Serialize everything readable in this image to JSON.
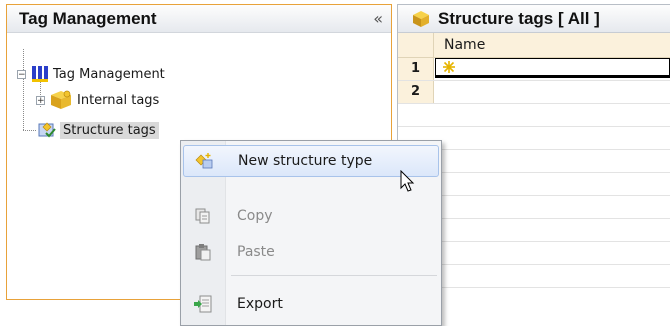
{
  "left_panel": {
    "title": "Tag Management",
    "collapse_glyph": "«",
    "tree": [
      {
        "label": "Tag Management",
        "expander": "−",
        "icon": "tag-management-icon"
      },
      {
        "label": "Internal tags",
        "expander": "+",
        "icon": "internal-tags-icon"
      },
      {
        "label": "Structure tags",
        "icon": "structure-tags-icon",
        "selected": true
      }
    ]
  },
  "right_panel": {
    "title": "Structure tags [ All ]",
    "icon": "structure-cube-icon",
    "column_name": "Name",
    "rows": [
      "1",
      "2"
    ]
  },
  "context_menu": {
    "items": [
      {
        "label": "New structure type",
        "icon": "new-structure-icon",
        "state": "hover"
      },
      {
        "label": "Copy",
        "icon": "copy-icon",
        "state": "disabled"
      },
      {
        "label": "Paste",
        "icon": "paste-icon",
        "state": "disabled"
      },
      {
        "label": "Export",
        "icon": "export-icon",
        "state": "normal"
      }
    ]
  },
  "colors": {
    "panel_border": "#e8a23a",
    "row_header_bg": "#fbf1dc",
    "menu_hover": "#dbe7fa"
  }
}
